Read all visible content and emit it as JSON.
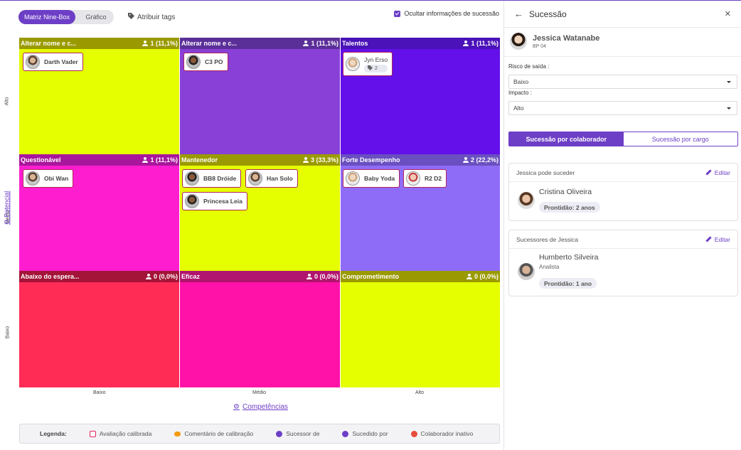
{
  "toolbar": {
    "seg_nine_box": "Matriz Nine-Box",
    "seg_grafico": "Gráfico",
    "attribute_tags": "Atribuir tags",
    "hide_info": "Ocultar informações de sucessão"
  },
  "axis": {
    "y_high": "Alto",
    "y_mid": "Médio",
    "y_low": "Baixo",
    "y_link": "Potencial",
    "x_low": "Baixo",
    "x_mid": "Médio",
    "x_high": "Alto",
    "x_link": "Competências"
  },
  "cells": [
    {
      "title": "Alterar nome e c...",
      "count": "1 (11,1%)",
      "head_color": "#9a9a00",
      "body_color": "#e5ff00"
    },
    {
      "title": "Alterar nome e c...",
      "count": "1 (11,1%)",
      "head_color": "#5b2f98",
      "body_color": "#8840d6"
    },
    {
      "title": "Talentos",
      "count": "1 (11,1%)",
      "head_color": "#4a12b8",
      "body_color": "#6310ea"
    },
    {
      "title": "Questionável",
      "count": "1 (11,1%)",
      "head_color": "#a8169c",
      "body_color": "#ff1ecf"
    },
    {
      "title": "Mantenedor",
      "count": "3 (33,3%)",
      "head_color": "#9a9a00",
      "body_color": "#e5ff00"
    },
    {
      "title": "Forte Desempenho",
      "count": "2 (22,2%)",
      "head_color": "#6a4fc0",
      "body_color": "#8f6cf7"
    },
    {
      "title": "Abaixo do espera...",
      "count": "0 (0,0%)",
      "head_color": "#a31438",
      "body_color": "#ff2c56"
    },
    {
      "title": "Eficaz",
      "count": "0 (0,0%)",
      "head_color": "#b0146e",
      "body_color": "#ff12a8"
    },
    {
      "title": "Comprometimento",
      "count": "0 (0,0%)",
      "head_color": "#9a9a00",
      "body_color": "#e5ff00"
    }
  ],
  "people": {
    "darth": "Darth Vader",
    "c3po": "C3 PO",
    "jyn": "Jyn Erso",
    "jyn_tags": "2",
    "obi": "Obi Wan",
    "bb8": "BB8 Dróide",
    "han": "Han Solo",
    "leia": "Princesa Leia",
    "yoda": "Baby Yoda",
    "r2d2": "R2 D2"
  },
  "legend": {
    "title": "Legenda:",
    "calibrated": "Avaliação calibrada",
    "comment": "Comentário de calibração",
    "successor": "Sucessor de",
    "succeeded": "Sucedido por",
    "inactive": "Colaborador inativo"
  },
  "panel": {
    "title": "Sucessão",
    "person_name": "Jessica Watanabe",
    "person_sub": "BP 04",
    "risk_label": "Risco de saída :",
    "risk_value": "Baixo",
    "impact_label": "Impacto :",
    "impact_value": "Alto",
    "tab_collab": "Sucessão por colaborador",
    "tab_role": "Sucessão por cargo",
    "can_succeed_title": "Jessica pode suceder",
    "edit": "Editar",
    "cs_name": "Cristina Oliveira",
    "cs_readiness": "Prontidão: 2 anos",
    "successors_title": "Sucessores de Jessica",
    "su_name": "Humberto Silveira",
    "su_role": "Analista",
    "su_readiness": "Prontidão: 1 ano"
  }
}
